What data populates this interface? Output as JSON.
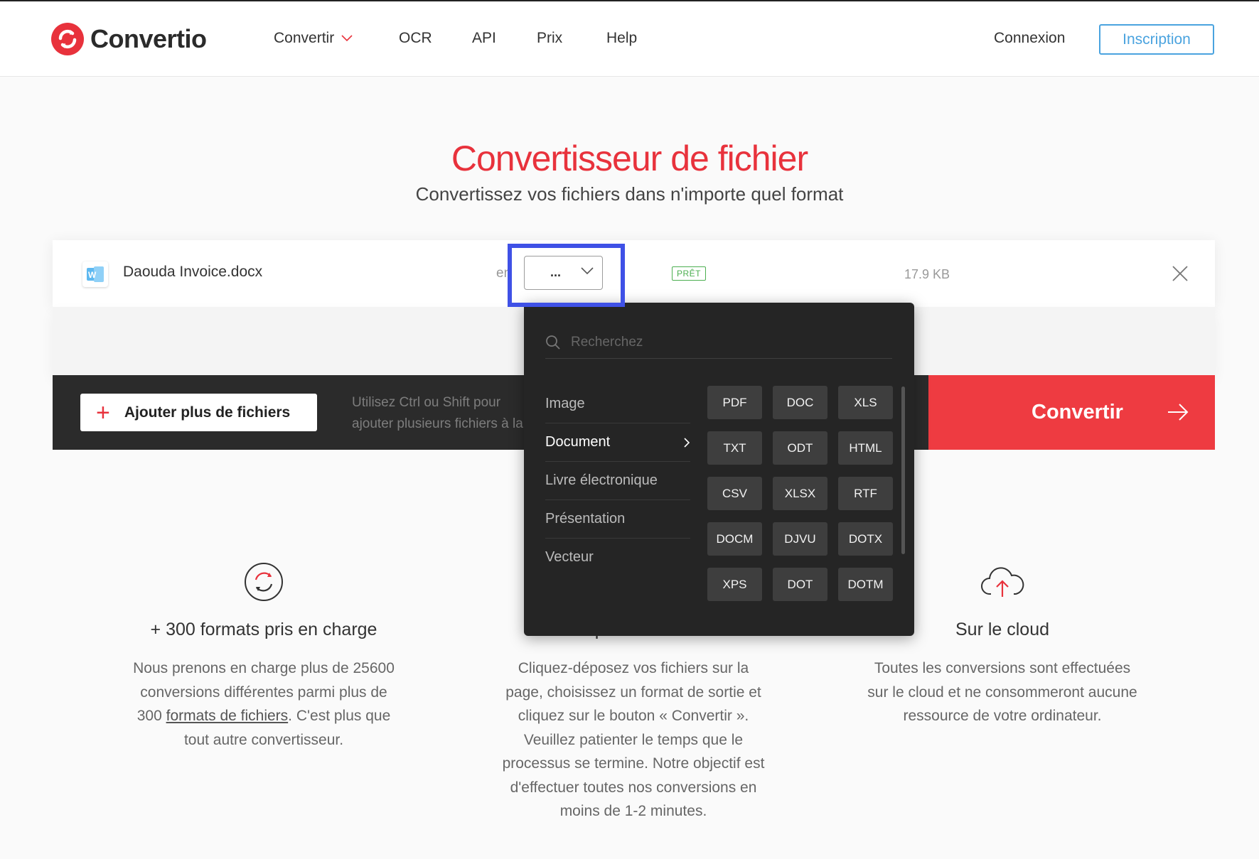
{
  "brand": {
    "name": "Convertio",
    "color": "#e8323c"
  },
  "nav": {
    "items": [
      {
        "label": "Convertir",
        "has_dropdown": true
      },
      {
        "label": "OCR"
      },
      {
        "label": "API"
      },
      {
        "label": "Prix"
      },
      {
        "label": "Help"
      }
    ],
    "login": "Connexion",
    "signup": "Inscription"
  },
  "hero": {
    "title": "Convertisseur de fichier",
    "subtitle": "Convertissez vos fichiers dans n'importe quel format"
  },
  "file": {
    "name": "Daouda Invoice.docx",
    "icon": "word-document-icon",
    "to_label": "en",
    "selected_format": "...",
    "status": "PRÊT",
    "size": "17.9 KB"
  },
  "actions": {
    "add_files": "Ajouter plus de fichiers",
    "hint": "Utilisez Ctrl ou Shift pour ajouter plusieurs fichiers à la fois.",
    "convert": "Convertir"
  },
  "dropdown": {
    "search_placeholder": "Recherchez",
    "categories": [
      "Image",
      "Document",
      "Livre électronique",
      "Présentation",
      "Vecteur"
    ],
    "active_category": "Document",
    "formats": [
      "PDF",
      "DOC",
      "XLS",
      "TXT",
      "ODT",
      "HTML",
      "CSV",
      "XLSX",
      "RTF",
      "DOCM",
      "DJVU",
      "DOTX",
      "XPS",
      "DOT",
      "DOTM"
    ]
  },
  "features": [
    {
      "icon": "refresh-icon",
      "title": "+ 300 formats pris en charge",
      "text_before": "Nous prenons en charge plus de 25600 conversions différentes parmi plus de 300 ",
      "link": "formats de fichiers",
      "text_after": ". C'est plus que tout autre convertisseur."
    },
    {
      "icon": "clock-icon",
      "title": "Rapide et facile",
      "text": "Cliquez-déposez vos fichiers sur la page, choisissez un format de sortie et cliquez sur le bouton « Convertir ». Veuillez patienter le temps que le processus se termine. Notre objectif est d'effectuer toutes nos conversions en moins de 1-2 minutes."
    },
    {
      "icon": "cloud-upload-icon",
      "title": "Sur le cloud",
      "text": "Toutes les conversions sont effectuées sur le cloud et ne consommeront aucune ressource de votre ordinateur."
    }
  ],
  "colors": {
    "accent": "#e8323c",
    "highlight": "#3f51e6",
    "signup": "#4aa3df",
    "status_ok": "#4caf50"
  }
}
